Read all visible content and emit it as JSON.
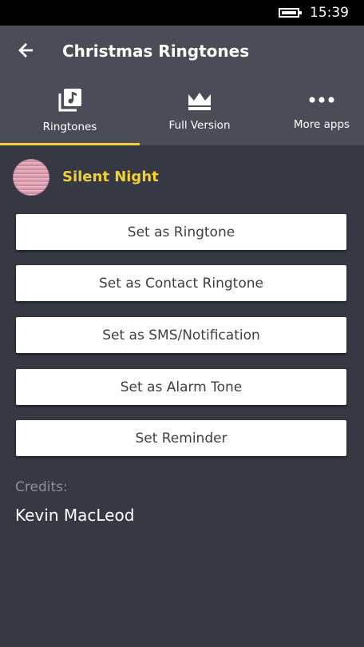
{
  "status_bar": {
    "time": "15:39",
    "battery_icon": "battery-icon"
  },
  "header": {
    "back_icon": "arrow-left-icon",
    "title": "Christmas Ringtones"
  },
  "tabs": [
    {
      "label": "Ringtones",
      "icon": "music-library-icon",
      "selected": true
    },
    {
      "label": "Full Version",
      "icon": "crown-icon",
      "selected": false
    },
    {
      "label": "More apps",
      "icon": "more-dots-icon",
      "selected": false
    }
  ],
  "song": {
    "title": "Silent Night"
  },
  "actions": [
    {
      "label": "Set as Ringtone"
    },
    {
      "label": "Set as Contact Ringtone"
    },
    {
      "label": "Set as SMS/Notification"
    },
    {
      "label": "Set as Alarm Tone"
    },
    {
      "label": "Set Reminder"
    }
  ],
  "credits": {
    "label": "Credits:",
    "name": "Kevin MacLeod"
  },
  "colors": {
    "background": "#363943",
    "header": "#4a4d58",
    "accent": "#f2d034",
    "button_bg": "#ffffff",
    "button_text": "#3b3e46",
    "muted_text": "#8d909a"
  }
}
